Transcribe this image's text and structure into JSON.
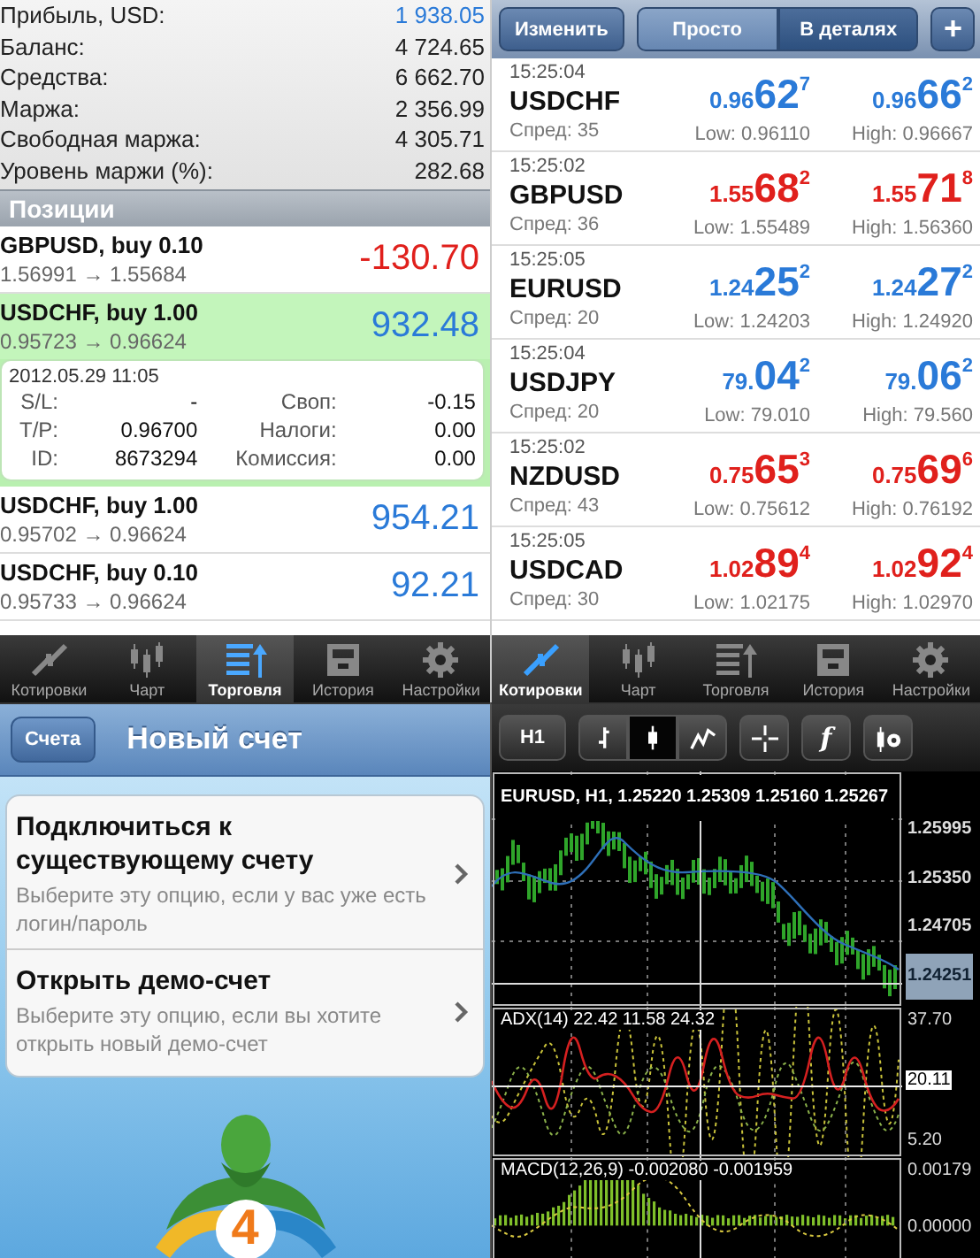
{
  "trade_screen": {
    "summary": [
      {
        "label": "Прибыль, USD:",
        "value": "1 938.05",
        "highlight": true
      },
      {
        "label": "Баланс:",
        "value": "4 724.65",
        "highlight": false
      },
      {
        "label": "Средства:",
        "value": "6 662.70",
        "highlight": false
      },
      {
        "label": "Маржа:",
        "value": "2 356.99",
        "highlight": false
      },
      {
        "label": "Свободная маржа:",
        "value": "4 305.71",
        "highlight": false
      },
      {
        "label": "Уровень маржи (%):",
        "value": "282.68",
        "highlight": false
      }
    ],
    "section_title": "Позиции",
    "positions": [
      {
        "title": "GBPUSD, buy 0.10",
        "prices": "1.56991 → 1.55684",
        "profit": "-130.70",
        "negative": true,
        "selected": false
      },
      {
        "title": "USDCHF, buy 1.00",
        "prices": "0.95723 → 0.96624",
        "profit": "932.48",
        "negative": false,
        "selected": true,
        "details": {
          "time": "2012.05.29 11:05",
          "rows": [
            {
              "label": "S/L:",
              "value": "-",
              "label_2": "Своп:",
              "value_2": "-0.15"
            },
            {
              "label": "T/P:",
              "value": "0.96700",
              "label_2": "Налоги:",
              "value_2": "0.00"
            },
            {
              "label": "ID:",
              "value": "8673294",
              "label_2": "Комиссия:",
              "value_2": "0.00"
            }
          ]
        }
      },
      {
        "title": "USDCHF, buy 1.00",
        "prices": "0.95702 → 0.96624",
        "profit": "954.21",
        "negative": false,
        "selected": false
      },
      {
        "title": "USDCHF, buy 0.10",
        "prices": "0.95733 → 0.96624",
        "profit": "92.21",
        "negative": false,
        "selected": false
      }
    ],
    "tab_bar": [
      {
        "kind": "quotes",
        "label": "Котировки",
        "selected": false
      },
      {
        "kind": "chart",
        "label": "Чарт",
        "selected": false
      },
      {
        "kind": "trade",
        "label": "Торговля",
        "selected": true
      },
      {
        "kind": "history",
        "label": "История",
        "selected": false
      },
      {
        "kind": "settings",
        "label": "Настройки",
        "selected": false
      }
    ]
  },
  "quotes_screen": {
    "edit_button": "Изменить",
    "view_modes": [
      {
        "label": "Просто",
        "selected": false
      },
      {
        "label": "В деталях",
        "selected": true
      }
    ],
    "add_button": "+",
    "quotes": [
      {
        "time": "15:25:04",
        "symbol": "USDCHF",
        "spread": "Спред: 35",
        "falling": false,
        "bid": {
          "head": "0.96",
          "pips": "62",
          "tail": "7"
        },
        "ask": {
          "head": "0.96",
          "pips": "66",
          "tail": "2"
        },
        "low": "Low: 0.96110",
        "high": "High: 0.96667"
      },
      {
        "time": "15:25:02",
        "symbol": "GBPUSD",
        "spread": "Спред: 36",
        "falling": true,
        "bid": {
          "head": "1.55",
          "pips": "68",
          "tail": "2"
        },
        "ask": {
          "head": "1.55",
          "pips": "71",
          "tail": "8"
        },
        "low": "Low: 1.55489",
        "high": "High: 1.56360"
      },
      {
        "time": "15:25:05",
        "symbol": "EURUSD",
        "spread": "Спред: 20",
        "falling": false,
        "bid": {
          "head": "1.24",
          "pips": "25",
          "tail": "2"
        },
        "ask": {
          "head": "1.24",
          "pips": "27",
          "tail": "2"
        },
        "low": "Low: 1.24203",
        "high": "High: 1.24920"
      },
      {
        "time": "15:25:04",
        "symbol": "USDJPY",
        "spread": "Спред: 20",
        "falling": false,
        "bid": {
          "head": "79.",
          "pips": "04",
          "tail": "2"
        },
        "ask": {
          "head": "79.",
          "pips": "06",
          "tail": "2"
        },
        "low": "Low: 79.010",
        "high": "High: 79.560"
      },
      {
        "time": "15:25:02",
        "symbol": "NZDUSD",
        "spread": "Спред: 43",
        "falling": true,
        "bid": {
          "head": "0.75",
          "pips": "65",
          "tail": "3"
        },
        "ask": {
          "head": "0.75",
          "pips": "69",
          "tail": "6"
        },
        "low": "Low: 0.75612",
        "high": "High: 0.76192"
      },
      {
        "time": "15:25:05",
        "symbol": "USDCAD",
        "spread": "Спред: 30",
        "falling": true,
        "bid": {
          "head": "1.02",
          "pips": "89",
          "tail": "4"
        },
        "ask": {
          "head": "1.02",
          "pips": "92",
          "tail": "4"
        },
        "low": "Low: 1.02175",
        "high": "High: 1.02970"
      }
    ],
    "tab_bar": [
      {
        "kind": "quotes",
        "label": "Котировки",
        "selected": true
      },
      {
        "kind": "chart",
        "label": "Чарт",
        "selected": false
      },
      {
        "kind": "trade",
        "label": "Торговля",
        "selected": false
      },
      {
        "kind": "history",
        "label": "История",
        "selected": false
      },
      {
        "kind": "settings",
        "label": "Настройки",
        "selected": false
      }
    ]
  },
  "new_account_screen": {
    "back_button": "Счета",
    "title": "Новый счет",
    "options": [
      {
        "title": "Подключиться к существующему счету",
        "description": "Выберите эту опцию, если у вас уже есть логин/пароль"
      },
      {
        "title": "Открыть демо-счет",
        "description": "Выберите эту опцию, если вы хотите открыть новый демо-счет"
      }
    ],
    "logo_number": "4"
  },
  "chart_screen": {
    "timeframe_button": "H1",
    "chart_types": [
      {
        "kind": "bars",
        "selected": false
      },
      {
        "kind": "candles",
        "selected": true
      },
      {
        "kind": "line",
        "selected": false
      }
    ],
    "function_button": "f",
    "panels": [
      {
        "kind": "price",
        "title": "EURUSD, H1, 1.25220 1.25309 1.25160 1.25267",
        "axis_labels": [
          {
            "text": "1.25995",
            "current": false
          },
          {
            "text": "1.25350",
            "current": false
          },
          {
            "text": "1.24705",
            "current": false
          },
          {
            "text": "1.24251",
            "current": true
          }
        ]
      },
      {
        "kind": "adx",
        "title": "ADX(14) 22.42 11.58 24.32",
        "axis_labels": [
          {
            "text": "37.70",
            "current": false
          },
          {
            "text": "20.11",
            "current": true
          },
          {
            "text": "5.20",
            "current": false
          }
        ]
      },
      {
        "kind": "macd",
        "title": "MACD(12,26,9) -0.002080 -0.001959",
        "axis_labels": [
          {
            "text": "0.00179"
          },
          {
            "text": "0.00000"
          }
        ]
      }
    ]
  }
}
